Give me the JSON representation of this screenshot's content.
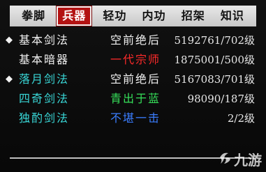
{
  "tabs": [
    {
      "label": "拳脚",
      "active": false
    },
    {
      "label": "兵器",
      "active": true
    },
    {
      "label": "轻功",
      "active": false
    },
    {
      "label": "内功",
      "active": false
    },
    {
      "label": "招架",
      "active": false
    },
    {
      "label": "知识",
      "active": false
    }
  ],
  "skills": [
    {
      "marker": "◆",
      "name": "基本剑法",
      "name_color": "#f0f0f0",
      "rank": "空前绝后",
      "rank_color": "#f0f0f0",
      "level": "5192761/702级"
    },
    {
      "marker": "",
      "name": "基本暗器",
      "name_color": "#f0f0f0",
      "rank": "一代宗师",
      "rank_color": "#ff2a2a",
      "level": "1875001/500级"
    },
    {
      "marker": "◆",
      "name": "落月剑法",
      "name_color": "#39d7d7",
      "rank": "空前绝后",
      "rank_color": "#f0f0f0",
      "level": "5167083/701级"
    },
    {
      "marker": "",
      "name": "四奇剑法",
      "name_color": "#39d7d7",
      "rank": "青出于蓝",
      "rank_color": "#36e05a",
      "level": "98090/187级"
    },
    {
      "marker": "",
      "name": "独酌剑法",
      "name_color": "#39d7d7",
      "rank": "不堪一击",
      "rank_color": "#3a7dff",
      "level": "2/2级"
    }
  ],
  "watermark": {
    "text": "九游",
    "icon": "jiuyou-logo-icon"
  }
}
